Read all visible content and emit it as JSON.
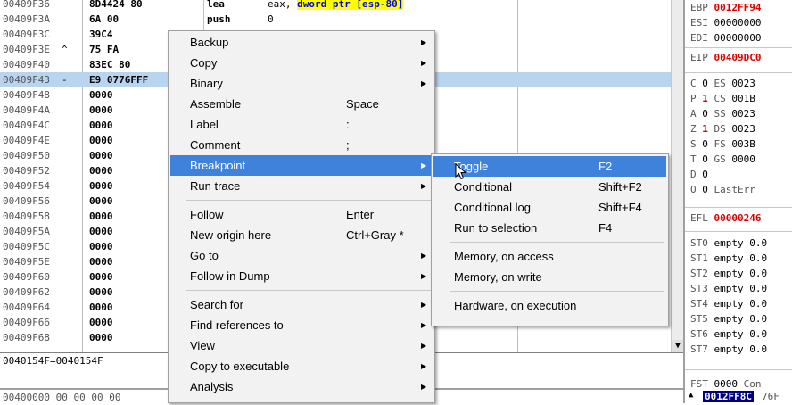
{
  "disasm": {
    "rows": [
      {
        "addr": "00409F36",
        "mark": "",
        "hex": "8D4424 80",
        "mnem": "lea",
        "op_pre": "eax, ",
        "op_hl": "dword ptr [esp-80]",
        "hl": false
      },
      {
        "addr": "00409F3A",
        "mark": "",
        "hex": "6A 00",
        "mnem": "push",
        "op_pre": "0",
        "op_hl": "",
        "hl": false
      },
      {
        "addr": "00409F3C",
        "mark": "",
        "hex": "39C4",
        "mnem": "",
        "op_pre": "",
        "op_hl": "",
        "hl": false
      },
      {
        "addr": "00409F3E",
        "mark": "^",
        "hex": "75 FA",
        "mnem": "",
        "op_pre": "",
        "op_hl": "",
        "hl": false
      },
      {
        "addr": "00409F40",
        "mark": "",
        "hex": "83EC 80",
        "mnem": "",
        "op_pre": "",
        "op_hl": "",
        "hl": false
      },
      {
        "addr": "00409F43",
        "mark": "-",
        "hex": "E9 0776FFF",
        "mnem": "",
        "op_pre": "",
        "op_hl": "",
        "hl": true
      },
      {
        "addr": "00409F48",
        "mark": "",
        "hex": "0000",
        "mnem": "",
        "op_pre": "",
        "op_hl": "",
        "hl": false
      },
      {
        "addr": "00409F4A",
        "mark": "",
        "hex": "0000",
        "mnem": "",
        "op_pre": "",
        "op_hl": "",
        "hl": false
      },
      {
        "addr": "00409F4C",
        "mark": "",
        "hex": "0000",
        "mnem": "",
        "op_pre": "",
        "op_hl": "",
        "hl": false
      },
      {
        "addr": "00409F4E",
        "mark": "",
        "hex": "0000",
        "mnem": "",
        "op_pre": "",
        "op_hl": "",
        "hl": false
      },
      {
        "addr": "00409F50",
        "mark": "",
        "hex": "0000",
        "mnem": "",
        "op_pre": "",
        "op_hl": "",
        "hl": false
      },
      {
        "addr": "00409F52",
        "mark": "",
        "hex": "0000",
        "mnem": "",
        "op_pre": "",
        "op_hl": "",
        "hl": false
      },
      {
        "addr": "00409F54",
        "mark": "",
        "hex": "0000",
        "mnem": "",
        "op_pre": "",
        "op_hl": "",
        "hl": false
      },
      {
        "addr": "00409F56",
        "mark": "",
        "hex": "0000",
        "mnem": "",
        "op_pre": "",
        "op_hl": "",
        "hl": false
      },
      {
        "addr": "00409F58",
        "mark": "",
        "hex": "0000",
        "mnem": "",
        "op_pre": "",
        "op_hl": "",
        "hl": false
      },
      {
        "addr": "00409F5A",
        "mark": "",
        "hex": "0000",
        "mnem": "",
        "op_pre": "",
        "op_hl": "",
        "hl": false
      },
      {
        "addr": "00409F5C",
        "mark": "",
        "hex": "0000",
        "mnem": "",
        "op_pre": "",
        "op_hl": "",
        "hl": false
      },
      {
        "addr": "00409F5E",
        "mark": "",
        "hex": "0000",
        "mnem": "",
        "op_pre": "",
        "op_hl": "",
        "hl": false
      },
      {
        "addr": "00409F60",
        "mark": "",
        "hex": "0000",
        "mnem": "",
        "op_pre": "",
        "op_hl": "",
        "hl": false
      },
      {
        "addr": "00409F62",
        "mark": "",
        "hex": "0000",
        "mnem": "",
        "op_pre": "",
        "op_hl": "",
        "hl": false
      },
      {
        "addr": "00409F64",
        "mark": "",
        "hex": "0000",
        "mnem": "",
        "op_pre": "",
        "op_hl": "",
        "hl": false
      },
      {
        "addr": "00409F66",
        "mark": "",
        "hex": "0000",
        "mnem": "",
        "op_pre": "",
        "op_hl": "",
        "hl": false
      },
      {
        "addr": "00409F68",
        "mark": "",
        "hex": "0000",
        "mnem": "",
        "op_pre": "",
        "op_hl": "",
        "hl": false
      }
    ],
    "highlight_color": "#ffff00",
    "highlight_text_color": "#0000ff"
  },
  "info": {
    "line": "0040154F=0040154F"
  },
  "dump": {
    "line": "00400000 00 00 00 00"
  },
  "registers": {
    "top": [
      {
        "name": "EBP",
        "value": "0012FF94",
        "changed": true
      },
      {
        "name": "ESI",
        "value": "00000000",
        "changed": false
      },
      {
        "name": "EDI",
        "value": "00000000",
        "changed": false
      }
    ],
    "eip": {
      "name": "EIP",
      "value": "00409DC0",
      "changed": true
    },
    "flags": [
      {
        "flag": "C",
        "bit": "0",
        "seg": "ES",
        "val": "0023",
        "changed": false
      },
      {
        "flag": "P",
        "bit": "1",
        "seg": "CS",
        "val": "001B",
        "changed": true
      },
      {
        "flag": "A",
        "bit": "0",
        "seg": "SS",
        "val": "0023",
        "changed": false
      },
      {
        "flag": "Z",
        "bit": "1",
        "seg": "DS",
        "val": "0023",
        "changed": true
      },
      {
        "flag": "S",
        "bit": "0",
        "seg": "FS",
        "val": "003B",
        "changed": false
      },
      {
        "flag": "T",
        "bit": "0",
        "seg": "GS",
        "val": "0000",
        "changed": false
      },
      {
        "flag": "D",
        "bit": "0",
        "seg": "",
        "val": "",
        "changed": false
      },
      {
        "flag": "O",
        "bit": "0",
        "seg": "LastErr",
        "val": "",
        "changed": false
      }
    ],
    "efl": {
      "name": "EFL",
      "value": "00000246",
      "changed": true
    },
    "fpu": [
      {
        "name": "ST0",
        "value": "empty 0.0"
      },
      {
        "name": "ST1",
        "value": "empty 0.0"
      },
      {
        "name": "ST2",
        "value": "empty 0.0"
      },
      {
        "name": "ST3",
        "value": "empty 0.0"
      },
      {
        "name": "ST4",
        "value": "empty 0.0"
      },
      {
        "name": "ST5",
        "value": "empty 0.0"
      },
      {
        "name": "ST6",
        "value": "empty 0.0"
      },
      {
        "name": "ST7",
        "value": "empty 0.0"
      }
    ],
    "fst": {
      "name": "FST",
      "value": "0000",
      "extra": "Con"
    },
    "stack_selected": "0012FF8C",
    "stack_next": "76F"
  },
  "context_menu": {
    "items": [
      {
        "label": "Backup",
        "shortcut": "",
        "submenu": true,
        "selected": false
      },
      {
        "label": "Copy",
        "shortcut": "",
        "submenu": true,
        "selected": false
      },
      {
        "label": "Binary",
        "shortcut": "",
        "submenu": true,
        "selected": false
      },
      {
        "label": "Assemble",
        "shortcut": "Space",
        "submenu": false,
        "selected": false
      },
      {
        "label": "Label",
        "shortcut": ":",
        "submenu": false,
        "selected": false
      },
      {
        "label": "Comment",
        "shortcut": ";",
        "submenu": false,
        "selected": false
      },
      {
        "label": "Breakpoint",
        "shortcut": "",
        "submenu": true,
        "selected": true
      },
      {
        "label": "Run trace",
        "shortcut": "",
        "submenu": true,
        "selected": false
      },
      {
        "separator": true
      },
      {
        "label": "Follow",
        "shortcut": "Enter",
        "submenu": false,
        "selected": false
      },
      {
        "label": "New origin here",
        "shortcut": "Ctrl+Gray *",
        "submenu": false,
        "selected": false
      },
      {
        "label": "Go to",
        "shortcut": "",
        "submenu": true,
        "selected": false
      },
      {
        "label": "Follow in Dump",
        "shortcut": "",
        "submenu": true,
        "selected": false
      },
      {
        "separator": true
      },
      {
        "label": "Search for",
        "shortcut": "",
        "submenu": true,
        "selected": false
      },
      {
        "label": "Find references to",
        "shortcut": "",
        "submenu": true,
        "selected": false
      },
      {
        "label": "View",
        "shortcut": "",
        "submenu": true,
        "selected": false
      },
      {
        "label": "Copy to executable",
        "shortcut": "",
        "submenu": true,
        "selected": false
      },
      {
        "label": "Analysis",
        "shortcut": "",
        "submenu": true,
        "selected": false
      }
    ]
  },
  "breakpoint_submenu": {
    "items": [
      {
        "label": "Toggle",
        "shortcut": "F2",
        "selected": true
      },
      {
        "label": "Conditional",
        "shortcut": "Shift+F2",
        "selected": false
      },
      {
        "label": "Conditional log",
        "shortcut": "Shift+F4",
        "selected": false
      },
      {
        "label": "Run to selection",
        "shortcut": "F4",
        "selected": false
      },
      {
        "separator": true
      },
      {
        "label": "Memory, on access",
        "shortcut": "",
        "selected": false
      },
      {
        "label": "Memory, on write",
        "shortcut": "",
        "selected": false
      },
      {
        "separator": true
      },
      {
        "label": "Hardware, on execution",
        "shortcut": "",
        "selected": false
      }
    ]
  }
}
